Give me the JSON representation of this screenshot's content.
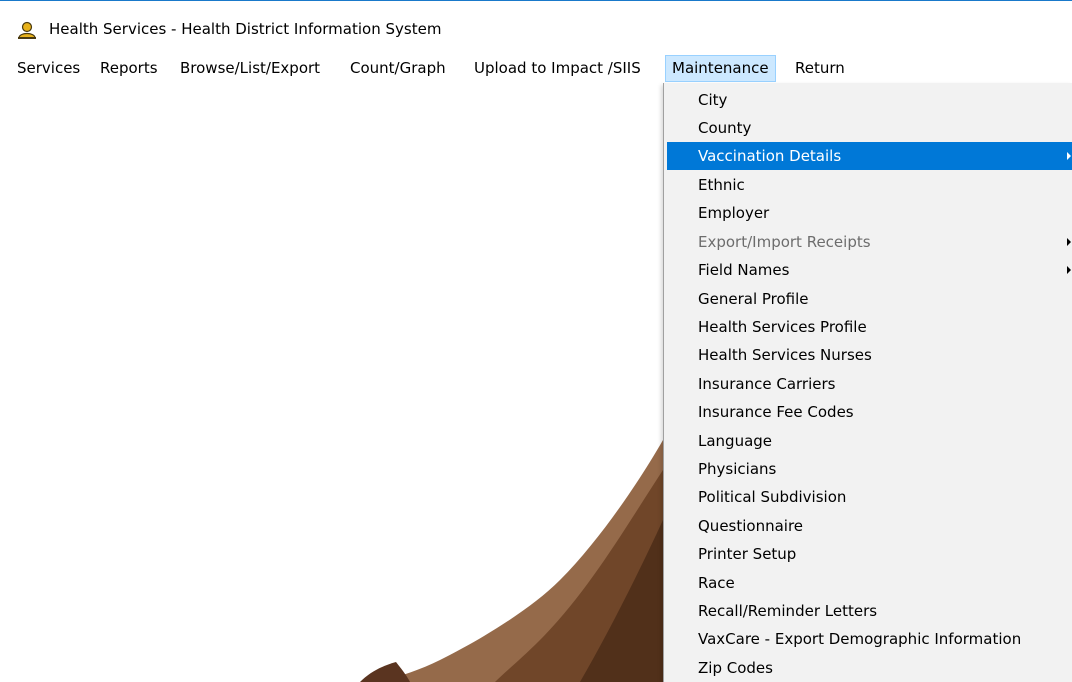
{
  "window": {
    "title": "Health Services - Health District Information System",
    "icon": "user-person-icon"
  },
  "menubar": {
    "items": [
      {
        "label": "Services"
      },
      {
        "label": "Reports"
      },
      {
        "label": "Browse/List/Export"
      },
      {
        "label": "Count/Graph"
      },
      {
        "label": "Upload to Impact /SIIS"
      },
      {
        "label": "Maintenance",
        "open": true
      },
      {
        "label": "Return"
      }
    ]
  },
  "maintenance_menu": {
    "items": [
      {
        "label": "City"
      },
      {
        "label": "County"
      },
      {
        "label": "Vaccination Details",
        "selected": true,
        "submenu": true
      },
      {
        "label": "Ethnic"
      },
      {
        "label": "Employer"
      },
      {
        "label": "Export/Import Receipts",
        "disabled": true,
        "submenu": true
      },
      {
        "label": "Field Names",
        "submenu": true
      },
      {
        "label": "General Profile"
      },
      {
        "label": "Health Services Profile"
      },
      {
        "label": "Health Services Nurses"
      },
      {
        "label": "Insurance Carriers"
      },
      {
        "label": "Insurance Fee Codes"
      },
      {
        "label": "Language"
      },
      {
        "label": "Physicians"
      },
      {
        "label": "Political Subdivision"
      },
      {
        "label": "Questionnaire"
      },
      {
        "label": "Printer Setup"
      },
      {
        "label": "Race"
      },
      {
        "label": "Recall/Reminder Letters"
      },
      {
        "label": "VaxCare - Export Demographic Information"
      },
      {
        "label": "Zip Codes"
      }
    ]
  },
  "colors": {
    "menu_background": "#f2f2f2",
    "selected_background": "#0078d7",
    "selected_text": "#ffffff",
    "disabled_text": "#6d6d6d",
    "open_menu_highlight": "#cce8ff"
  }
}
